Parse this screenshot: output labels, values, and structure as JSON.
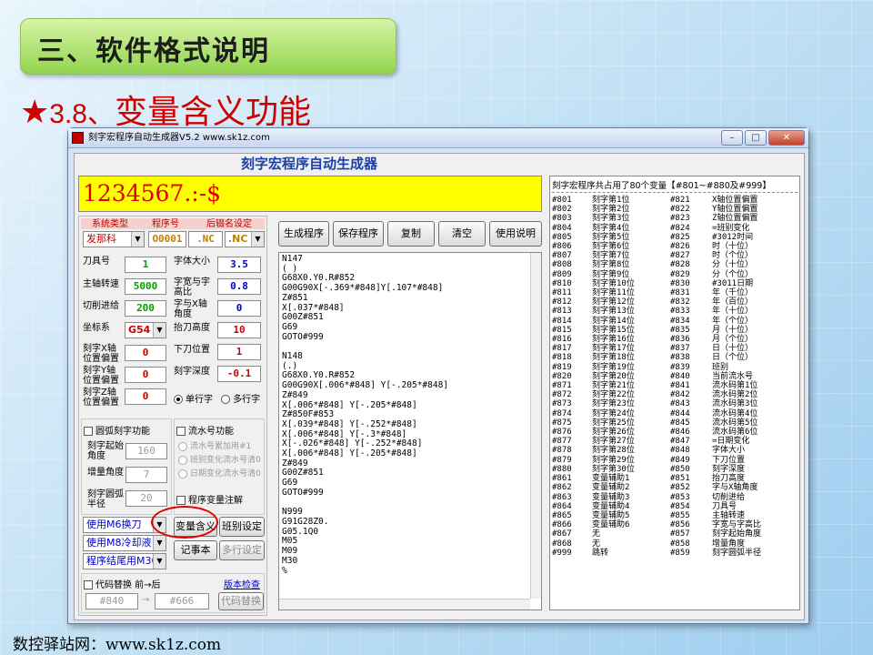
{
  "slide": {
    "title": "三、软件格式说明",
    "subtitle_star": "★",
    "subtitle_num": "3.8、",
    "subtitle_text": "变量含义功能",
    "footer": "数控驿站网：www.sk1z.com"
  },
  "window": {
    "title": "刻字宏程序自动生成器V5.2    www.sk1z.com",
    "min": "–",
    "max": "□",
    "close": "✕"
  },
  "app": {
    "heading": "刻字宏程序自动生成器",
    "preview": "1234567.:-$",
    "sys": {
      "label_type": "系统类型",
      "label_prog": "程序号",
      "label_ext": "后辍名设定",
      "type_value": "发那科",
      "prog_value": "O0001",
      "ext1": ".NC",
      "ext2": ".NC"
    },
    "params": [
      {
        "label": "刀具号",
        "value": "1",
        "cls": "grn"
      },
      {
        "label": "主轴转速",
        "value": "5000",
        "cls": "grn"
      },
      {
        "label": "切削进给",
        "value": "200",
        "cls": "grn"
      },
      {
        "label": "坐标系",
        "value": "G54",
        "cls": "rd"
      },
      {
        "label": "刻字X轴位置偏置",
        "value": "0",
        "cls": "rd"
      },
      {
        "label": "刻字Y轴位置偏置",
        "value": "0",
        "cls": "rd"
      },
      {
        "label": "刻字Z轴位置偏置",
        "value": "0",
        "cls": "rd"
      }
    ],
    "params_r": [
      {
        "label": "字体大小",
        "value": "3.5",
        "cls": "blu"
      },
      {
        "label": "字宽与字高比",
        "value": "0.8",
        "cls": "blu"
      },
      {
        "label": "字与X轴角度",
        "value": "0",
        "cls": "blu"
      },
      {
        "label": "抬刀高度",
        "value": "10",
        "cls": "rd"
      },
      {
        "label": "下刀位置",
        "value": "1",
        "cls": "rd"
      },
      {
        "label": "刻字深度",
        "value": "-0.1",
        "cls": "rd"
      }
    ],
    "radio_single": "单行字",
    "radio_multi": "多行字",
    "arc": {
      "check": "圆弧刻字功能",
      "start_label": "刻字起始角度",
      "start": "160",
      "inc_label": "增量角度",
      "inc": "7",
      "radius_label": "刻字圆弧半径",
      "radius": "20"
    },
    "serial": {
      "check": "流水号功能",
      "o1": "流水号累加用#1",
      "o2": "班别变化流水号清0",
      "o3": "日期变化流水号清0",
      "var_check": "程序变量注解"
    },
    "combos": [
      "使用M6换刀",
      "使用M8冷却液",
      "程序结尾用M30"
    ],
    "buttons": {
      "var_meaning": "变量含义",
      "shift": "班别设定",
      "notepad": "记事本",
      "multi_set": "多行设定"
    },
    "replace": {
      "check": "代码替换 前→后",
      "from": "#840",
      "to": "#666",
      "btn": "代码替换",
      "link": "版本检查",
      "arrow": "→"
    },
    "toolbar": [
      "生成程序",
      "保存程序",
      "复制",
      "清空",
      "使用说明"
    ]
  },
  "editor_text": "N147\n( )\nG68X0.Y0.R#852\nG00G90X[-.369*#848]Y[.107*#848]\nZ#851\nX[.037*#848]\nG00Z#851\nG69\nGOTO#999\n\nN148\n(.)\nG68X0.Y0.R#852\nG00G90X[.006*#848] Y[-.205*#848]\nZ#849\nX[.006*#848] Y[-.205*#848]\nZ#850F#853\nX[.039*#848] Y[-.252*#848]\nX[.006*#848] Y[-.3*#848]\nX[-.026*#848] Y[-.252*#848]\nX[.006*#848] Y[-.205*#848]\nZ#849\nG00Z#851\nG69\nGOTO#999\n\nN999\nG91G28Z0.\nG05.1Q0\nM05\nM09\nM30\n%",
  "var_panel": {
    "header": "刻字宏程序共占用了80个变量【#801~#880及#999】",
    "rows": [
      [
        "#801",
        "刻字第1位",
        "#821",
        "X轴位置偏置"
      ],
      [
        "#802",
        "刻字第2位",
        "#822",
        "Y轴位置偏置"
      ],
      [
        "#803",
        "刻字第3位",
        "#823",
        "Z轴位置偏置"
      ],
      [
        "#804",
        "刻字第4位",
        "#824",
        "=班别变化"
      ],
      [
        "#805",
        "刻字第5位",
        "#825",
        "#3012时间"
      ],
      [
        "#806",
        "刻字第6位",
        "#826",
        "时（十位）"
      ],
      [
        "#807",
        "刻字第7位",
        "#827",
        "时（个位）"
      ],
      [
        "#808",
        "刻字第8位",
        "#828",
        "分（十位）"
      ],
      [
        "#809",
        "刻字第9位",
        "#829",
        "分（个位）"
      ],
      [
        "#810",
        "刻字第10位",
        "#830",
        "#3011日期"
      ],
      [
        "#811",
        "刻字第11位",
        "#831",
        "年（千位）"
      ],
      [
        "#812",
        "刻字第12位",
        "#832",
        "年（百位）"
      ],
      [
        "#813",
        "刻字第13位",
        "#833",
        "年（十位）"
      ],
      [
        "#814",
        "刻字第14位",
        "#834",
        "年（个位）"
      ],
      [
        "#815",
        "刻字第15位",
        "#835",
        "月（十位）"
      ],
      [
        "#816",
        "刻字第16位",
        "#836",
        "月（个位）"
      ],
      [
        "#817",
        "刻字第17位",
        "#837",
        "日（十位）"
      ],
      [
        "#818",
        "刻字第18位",
        "#838",
        "日（个位）"
      ],
      [
        "#819",
        "刻字第19位",
        "#839",
        "班别"
      ],
      [
        "#820",
        "刻字第20位",
        "#840",
        "当前流水号"
      ],
      [
        "#871",
        "刻字第21位",
        "#841",
        "流水码第1位"
      ],
      [
        "#872",
        "刻字第22位",
        "#842",
        "流水码第2位"
      ],
      [
        "#873",
        "刻字第23位",
        "#843",
        "流水码第3位"
      ],
      [
        "#874",
        "刻字第24位",
        "#844",
        "流水码第4位"
      ],
      [
        "#875",
        "刻字第25位",
        "#845",
        "流水码第5位"
      ],
      [
        "#876",
        "刻字第26位",
        "#846",
        "流水码第6位"
      ],
      [
        "#877",
        "刻字第27位",
        "#847",
        "=日期变化"
      ],
      [
        "#878",
        "刻字第28位",
        "#848",
        "字体大小"
      ],
      [
        "#879",
        "刻字第29位",
        "#849",
        "下刀位置"
      ],
      [
        "#880",
        "刻字第30位",
        "#850",
        "刻字深度"
      ],
      [
        "#861",
        "变量辅助1",
        "#851",
        "抬刀高度"
      ],
      [
        "#862",
        "变量辅助2",
        "#852",
        "字与X轴角度"
      ],
      [
        "#863",
        "变量辅助3",
        "#853",
        "切削进给"
      ],
      [
        "#864",
        "变量辅助4",
        "#854",
        "刀具号"
      ],
      [
        "#865",
        "变量辅助5",
        "#855",
        "主轴转速"
      ],
      [
        "#866",
        "变量辅助6",
        "#856",
        "字宽与字高比"
      ],
      [
        "#867",
        "无",
        "#857",
        "刻字起始角度"
      ],
      [
        "#868",
        "无",
        "#858",
        "增量角度"
      ],
      [
        "#999",
        "跳转",
        "#859",
        "刻字圆弧半径"
      ]
    ]
  }
}
